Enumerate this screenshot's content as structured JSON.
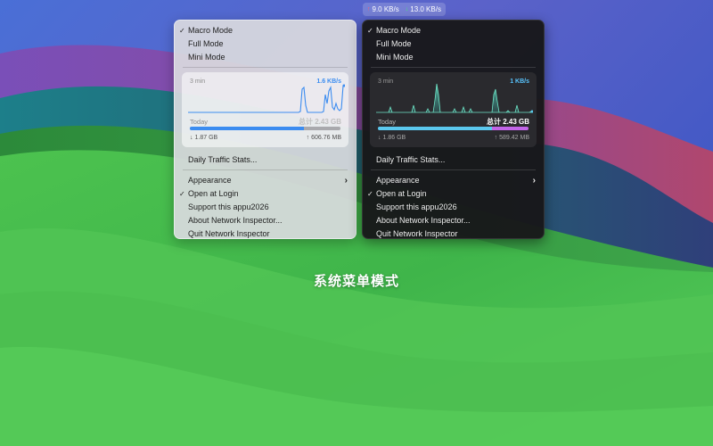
{
  "status_bar": {
    "upload_rate": "9.0 KB/s",
    "download_rate": "13.0 KB/s"
  },
  "menus": [
    {
      "theme": "light",
      "modes": [
        {
          "label": "Macro Mode",
          "checked": true
        },
        {
          "label": "Full Mode",
          "checked": false
        },
        {
          "label": "Mini Mode",
          "checked": false
        }
      ],
      "chart": {
        "range_label": "3 min",
        "peak_label": "1.6 KB/s",
        "today_label": "Today",
        "total_label": "总计 2.43 GB",
        "download_total": "1.87 GB",
        "upload_total": "606.76 MB",
        "download_fraction": 0.76
      },
      "daily_stats": "Daily Traffic Stats...",
      "appearance": "Appearance",
      "open_at_login": "Open at Login",
      "support": "Support this appu2026",
      "about": "About Network Inspector...",
      "quit": "Quit Network Inspector"
    },
    {
      "theme": "dark",
      "modes": [
        {
          "label": "Macro Mode",
          "checked": true
        },
        {
          "label": "Full Mode",
          "checked": false
        },
        {
          "label": "Mini Mode",
          "checked": false
        }
      ],
      "chart": {
        "range_label": "3 min",
        "peak_label": "1 KB/s",
        "today_label": "Today",
        "total_label": "总计 2.43 GB",
        "download_total": "1.86 GB",
        "upload_total": "589.42 MB",
        "download_fraction": 0.76
      },
      "daily_stats": "Daily Traffic Stats...",
      "appearance": "Appearance",
      "open_at_login": "Open at Login",
      "support": "Support this appu2026",
      "about": "About Network Inspector...",
      "quit": "Quit Network Inspector"
    }
  ],
  "caption": "系统菜单模式",
  "icons": {
    "check": "check-icon",
    "chevron": "chevron-right-icon",
    "arrow_up": "arrow-up-icon",
    "arrow_down": "arrow-down-icon"
  },
  "colors": {
    "light_accent": "#3b8cf0",
    "dark_download": "#5bc8ee",
    "dark_upload": "#c265e8",
    "status_upload": "#ff5a6e",
    "status_download": "#49e27a"
  }
}
